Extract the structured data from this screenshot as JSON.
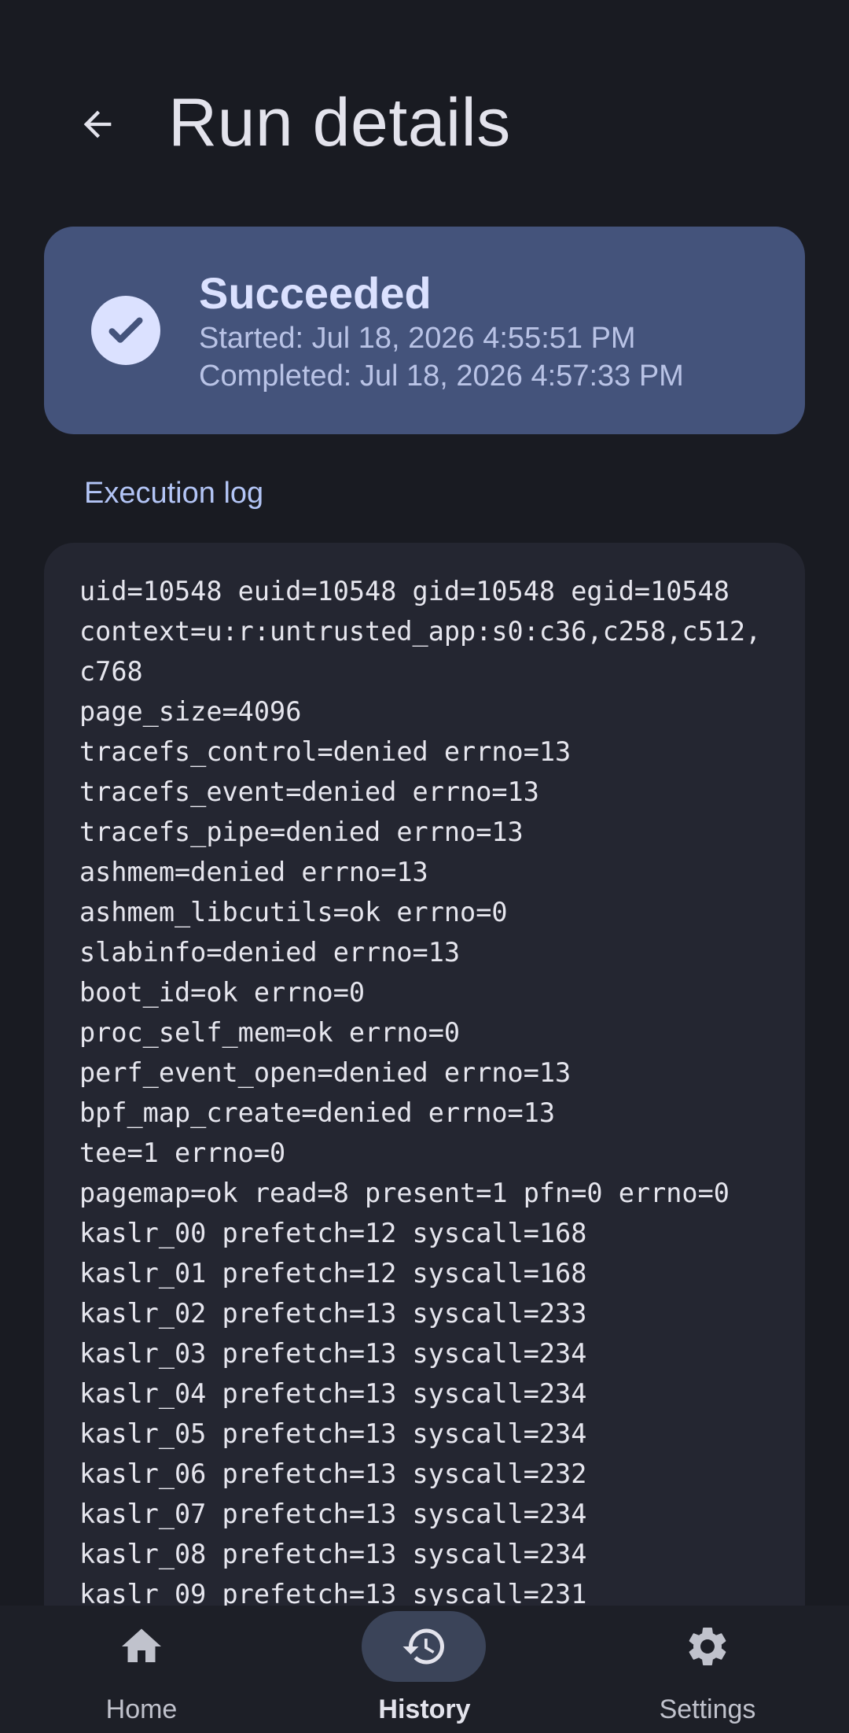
{
  "header": {
    "title": "Run details",
    "back_icon": "arrow-back-icon"
  },
  "status": {
    "title": "Succeeded",
    "started": "Started: Jul 18, 2026 4:55:51 PM",
    "completed": "Completed: Jul 18, 2026 4:57:33 PM",
    "icon": "check-circle-icon",
    "card_color": "#44537b"
  },
  "log": {
    "label": "Execution log",
    "lines": [
      "uid=10548 euid=10548 gid=10548 egid=10548",
      "context=u:r:untrusted_app:s0:c36,c258,c512,",
      "c768",
      "page_size=4096",
      "tracefs_control=denied errno=13",
      "tracefs_event=denied errno=13",
      "tracefs_pipe=denied errno=13",
      "ashmem=denied errno=13",
      "ashmem_libcutils=ok errno=0",
      "slabinfo=denied errno=13",
      "boot_id=ok errno=0",
      "proc_self_mem=ok errno=0",
      "perf_event_open=denied errno=13",
      "bpf_map_create=denied errno=13",
      "tee=1 errno=0",
      "pagemap=ok read=8 present=1 pfn=0 errno=0",
      "kaslr_00 prefetch=12 syscall=168",
      "kaslr_01 prefetch=12 syscall=168",
      "kaslr_02 prefetch=13 syscall=233",
      "kaslr_03 prefetch=13 syscall=234",
      "kaslr_04 prefetch=13 syscall=234",
      "kaslr_05 prefetch=13 syscall=234",
      "kaslr_06 prefetch=13 syscall=232",
      "kaslr_07 prefetch=13 syscall=234",
      "kaslr_08 prefetch=13 syscall=234",
      "kaslr_09 prefetch=13 syscall=231"
    ]
  },
  "nav": {
    "items": [
      {
        "label": "Home",
        "icon": "home-icon"
      },
      {
        "label": "History",
        "icon": "history-icon",
        "selected": true
      },
      {
        "label": "Settings",
        "icon": "gear-icon"
      }
    ]
  }
}
